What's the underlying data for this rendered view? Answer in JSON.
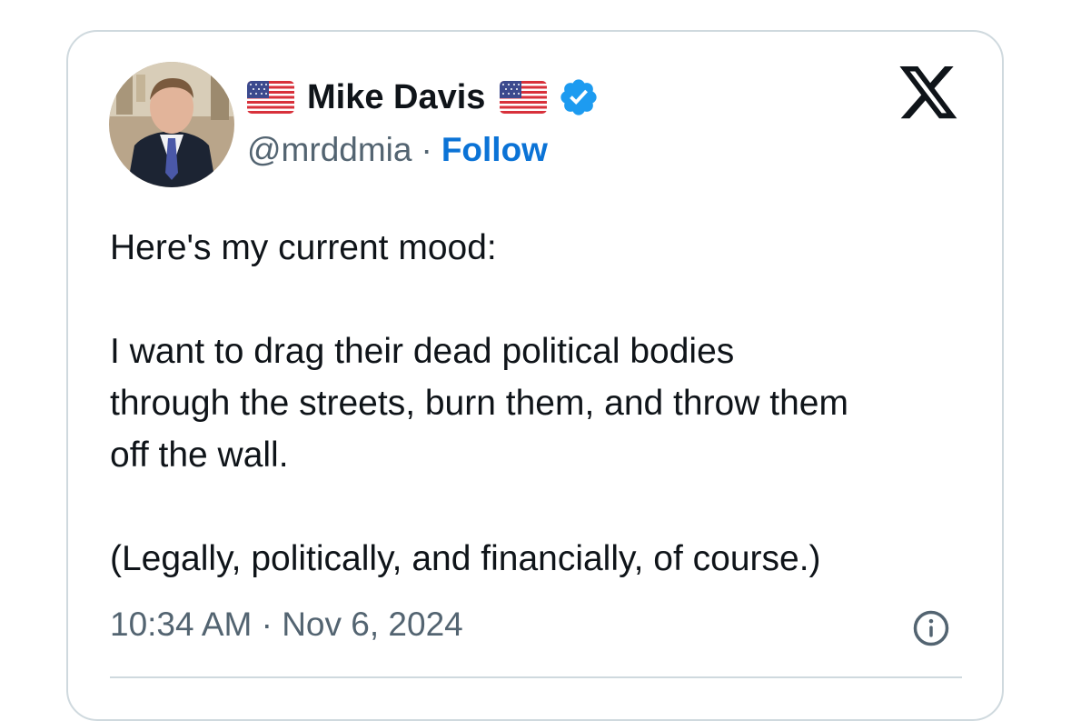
{
  "tweet": {
    "author": {
      "display_name": "Mike Davis",
      "handle": "@mrddmia",
      "verified": true,
      "flag_emoji": "flag-us"
    },
    "separator": "·",
    "follow_label": "Follow",
    "text_lines_1": [
      "Here's my current mood:"
    ],
    "text_lines_2": [
      "I want to drag their dead political bodies",
      "through the streets, burn them, and throw them",
      "off the wall."
    ],
    "text_lines_3": [
      "(Legally, politically, and financially, of course.)"
    ],
    "timestamp": "10:34 AM · Nov 6, 2024"
  },
  "icons": {
    "brand": "x-logo-icon",
    "verified": "verified-badge-icon",
    "info": "info-icon"
  },
  "colors": {
    "follow": "#0b73d6",
    "verified": "#1d9bf0",
    "secondary_text": "#536471",
    "border": "#cfd9de"
  }
}
